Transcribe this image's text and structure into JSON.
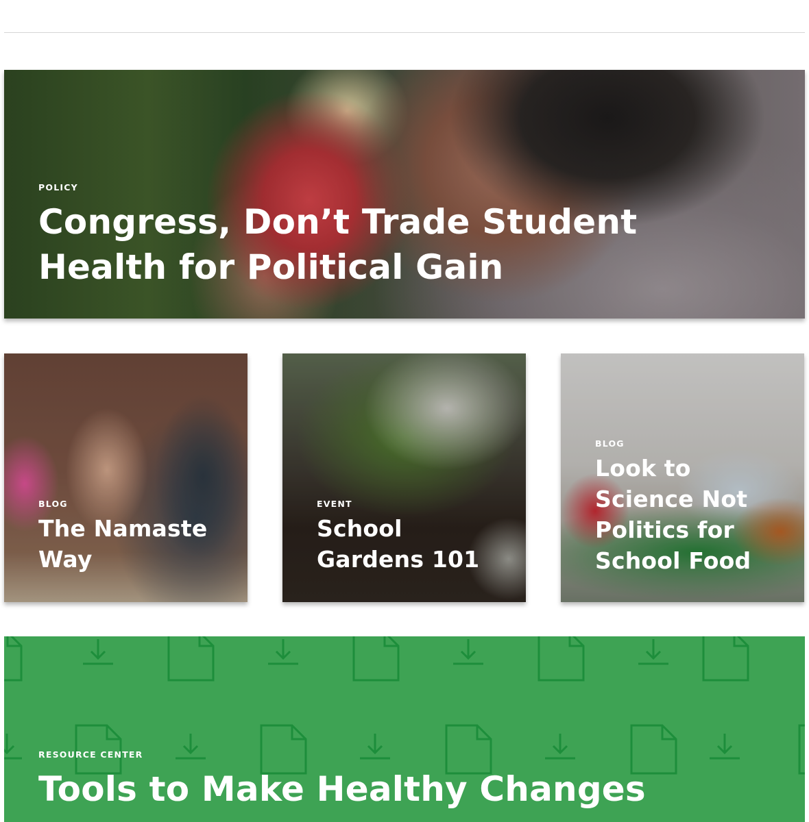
{
  "hero": {
    "eyebrow": "POLICY",
    "title": "Congress, Don’t Trade Student Health for Political Gain"
  },
  "cards": [
    {
      "eyebrow": "BLOG",
      "title": "The Namaste Way"
    },
    {
      "eyebrow": "EVENT",
      "title": "School Gardens 101"
    },
    {
      "eyebrow": "BLOG",
      "title": "Look to Science Not Politics for School Food"
    }
  ],
  "resource": {
    "eyebrow": "RESOURCE CENTER",
    "title": "Tools to Make Healthy Changes",
    "pattern_icons": [
      "document-icon",
      "download-icon"
    ]
  },
  "colors": {
    "resource_green": "#3ea354",
    "pattern_line_green": "#1d8e3b",
    "text_white": "#ffffff"
  }
}
